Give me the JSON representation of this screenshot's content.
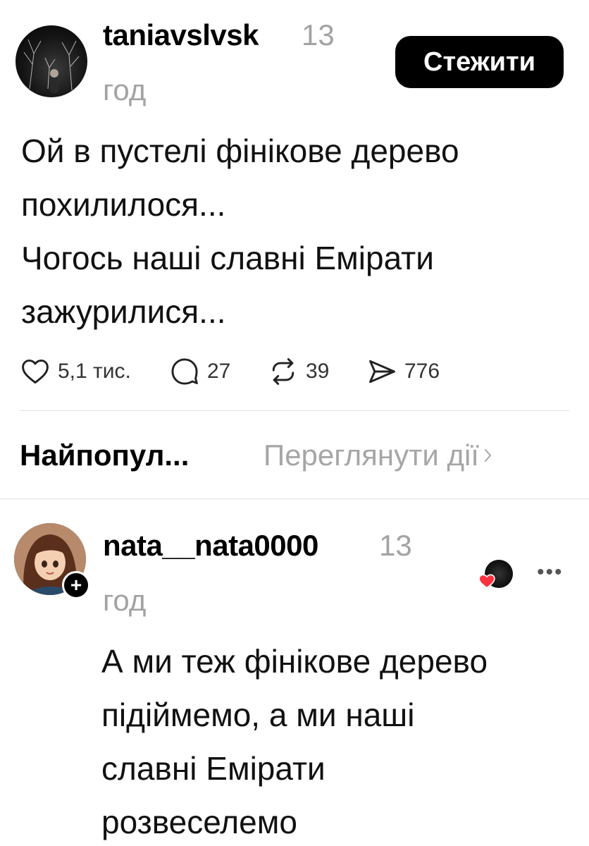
{
  "post": {
    "author": "taniavslvsk",
    "time_value": "13",
    "time_unit": "год",
    "follow_label": "Стежити",
    "text_lines": [
      "Ой в пустелі фінікове дерево",
      "похилилося...",
      "Чогось наші славні Емірати",
      "зажурилися..."
    ],
    "actions": {
      "likes": "5,1 тис.",
      "replies": "27",
      "reposts": "39",
      "shares": "776"
    }
  },
  "replies_bar": {
    "sort_label": "Найпопул...",
    "view_activity_label": "Переглянути дії"
  },
  "reply": {
    "author": "nata__nata0000",
    "time_value": "13",
    "time_unit": "год",
    "text_lines": [
      "А ми теж фінікове дерево",
      "підіймемо, а ми наші",
      "славні Емірати",
      "розвеселемо"
    ]
  },
  "colors": {
    "accent": "#000000",
    "muted": "#a3a3a3",
    "heart": "#ff3040",
    "divider": "#e2e2e2"
  }
}
